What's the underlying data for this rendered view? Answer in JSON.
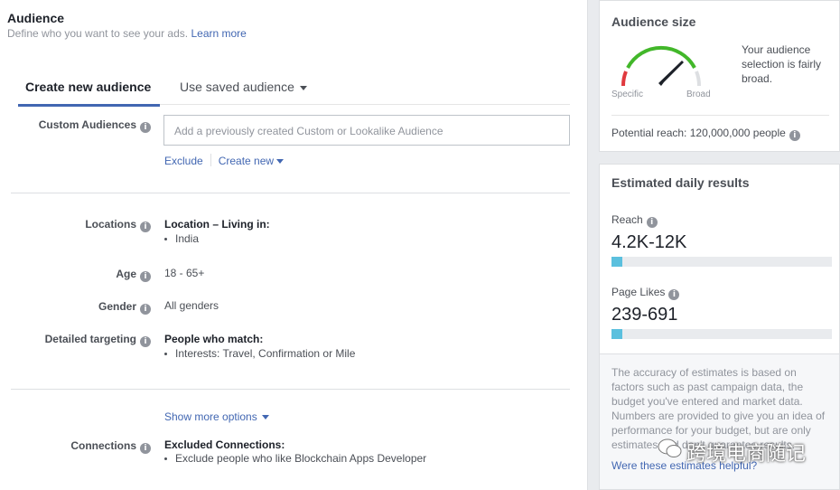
{
  "audience": {
    "title": "Audience",
    "subtitle": "Define who you want to see your ads.",
    "learn_more": "Learn more"
  },
  "tabs": {
    "create_new": "Create new audience",
    "use_saved": "Use saved audience"
  },
  "custom_audiences": {
    "label": "Custom Audiences",
    "placeholder": "Add a previously created Custom or Lookalike Audience",
    "exclude": "Exclude",
    "create_new": "Create new"
  },
  "locations": {
    "label": "Locations",
    "heading": "Location – Living in:",
    "items": [
      "India"
    ]
  },
  "age": {
    "label": "Age",
    "value": "18 - 65+"
  },
  "gender": {
    "label": "Gender",
    "value": "All genders"
  },
  "detailed_targeting": {
    "label": "Detailed targeting",
    "heading": "People who match:",
    "items": [
      "Interests: Travel, Confirmation or Mile"
    ]
  },
  "show_more": "Show more options",
  "connections": {
    "label": "Connections",
    "heading": "Excluded Connections:",
    "items": [
      "Exclude people who like Blockchain Apps Developer"
    ]
  },
  "audience_size": {
    "title": "Audience size",
    "specific": "Specific",
    "broad": "Broad",
    "description": "Your audience selection is fairly broad.",
    "potential_reach": "Potential reach: 120,000,000 people",
    "gauge_level": 0.78
  },
  "daily_results": {
    "title": "Estimated daily results",
    "reach_label": "Reach",
    "reach_value": "4.2K-12K",
    "reach_fill": 0.05,
    "likes_label": "Page Likes",
    "likes_value": "239-691",
    "likes_fill": 0.05
  },
  "estimate_note": "The accuracy of estimates is based on factors such as past campaign data, the budget you've entered and market data. Numbers are provided to give you an idea of performance for your budget, but are only estimates and don't guarantee results.",
  "estimate_link": "Were these estimates helpful?",
  "watermark": "跨境电商随记",
  "colors": {
    "link": "#4267b2",
    "bar_fill": "#5bc0de",
    "gauge_green": "#42b72a",
    "gauge_red": "#e0393e",
    "gauge_gray": "#dddfe2"
  }
}
